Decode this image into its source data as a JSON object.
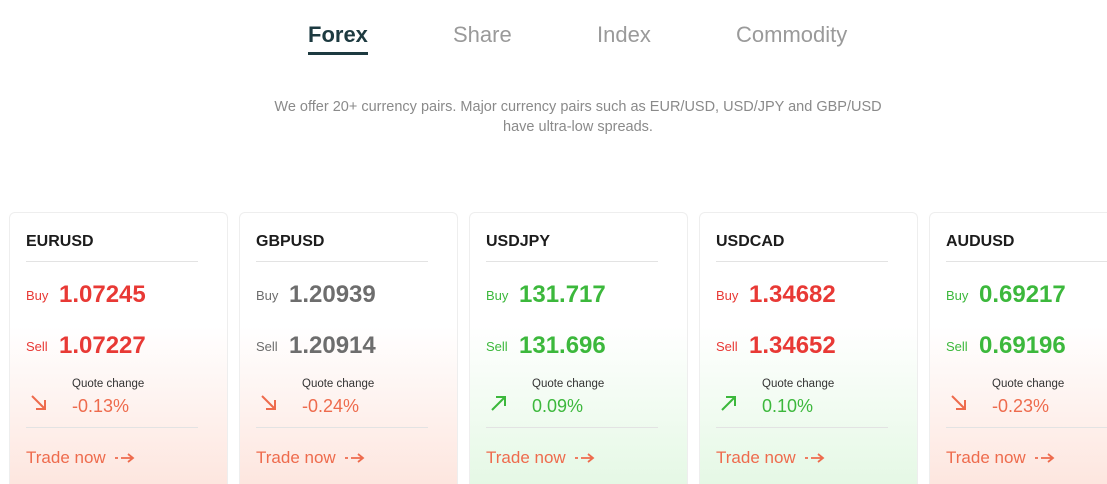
{
  "tabs": [
    {
      "label": "Forex",
      "active": true
    },
    {
      "label": "Share",
      "active": false
    },
    {
      "label": "Index",
      "active": false
    },
    {
      "label": "Commodity",
      "active": false
    }
  ],
  "description": {
    "line1": "We offer 20+ currency pairs. Major currency pairs such as EUR/USD, USD/JPY and GBP/USD",
    "line2": "have ultra-low spreads."
  },
  "labels": {
    "buy": "Buy",
    "sell": "Sell",
    "quote_change": "Quote change",
    "trade_now": "Trade now"
  },
  "cards": [
    {
      "symbol": "EURUSD",
      "buy": "1.07245",
      "sell": "1.07227",
      "change": "-0.13%",
      "direction": "down",
      "price_color": "#e83935"
    },
    {
      "symbol": "GBPUSD",
      "buy": "1.20939",
      "sell": "1.20914",
      "change": "-0.24%",
      "direction": "down",
      "price_color": "#6d6d6d"
    },
    {
      "symbol": "USDJPY",
      "buy": "131.717",
      "sell": "131.696",
      "change": "0.09%",
      "direction": "up",
      "price_color": "#3cb83c"
    },
    {
      "symbol": "USDCAD",
      "buy": "1.34682",
      "sell": "1.34652",
      "change": "0.10%",
      "direction": "up",
      "price_color": "#e83935"
    },
    {
      "symbol": "AUDUSD",
      "buy": "0.69217",
      "sell": "0.69196",
      "change": "-0.23%",
      "direction": "down",
      "price_color": "#3cb83c"
    }
  ],
  "colors": {
    "accent_dark": "#1d3a40",
    "down": "#ee6b4d",
    "up": "#3cb83c",
    "red_price": "#e83935"
  }
}
